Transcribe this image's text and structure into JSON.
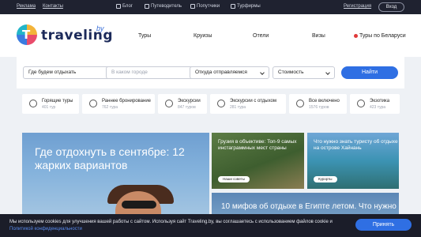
{
  "topbar": {
    "ads": "Реклама",
    "contacts": "Контакты",
    "links": [
      "Блог",
      "Путеводитель",
      "Попутчики",
      "Турфирмы"
    ],
    "register": "Регистрация",
    "login": "Вход"
  },
  "header": {
    "logo_letter": "T",
    "logo_text": "traveling",
    "logo_suffix": "by",
    "nav": [
      "Туры",
      "Круизы",
      "Отели",
      "Визы",
      "Туры по Беларуси"
    ]
  },
  "search": {
    "where": "Где будем отдыхать",
    "city_placeholder": "В каком городе",
    "from": "Откуда отправляемся",
    "price": "Стоимость",
    "find": "Найти"
  },
  "categories": [
    {
      "label": "Горящие туры",
      "count": "401 тур"
    },
    {
      "label": "Раннее бронирование",
      "count": "762 тура"
    },
    {
      "label": "Экскурсии",
      "count": "847 туров"
    },
    {
      "label": "Экскурсии с отдыхом",
      "count": "281 тура"
    },
    {
      "label": "Все включено",
      "count": "1576 туров"
    },
    {
      "label": "Экзотика",
      "count": "423 тура"
    }
  ],
  "cards": {
    "big_title": "Где отдохнуть в сентябре: 12 жарких вариантов",
    "card1_title": "Грузия в объективе: Топ-9 самых инстаграммных мест страны",
    "card1_tag": "Наши советы",
    "card2_title": "Что нужно знать туристу об отдыхе на острове Хайнань",
    "card2_tag": "Курорты",
    "card3_title": "10 мифов об отдыхе в Египте летом. Что нужно"
  },
  "cookie": {
    "text": "Мы используем cookies для улучшения вашей работы с сайтом. Используя сайт Traveling.by, вы соглашаетесь с использованием файлов cookie и",
    "link": "Политикой конфиденциальности",
    "accept": "Принять"
  },
  "colors": {
    "accent": "#2f6fe3",
    "topbar": "#1f2230"
  }
}
